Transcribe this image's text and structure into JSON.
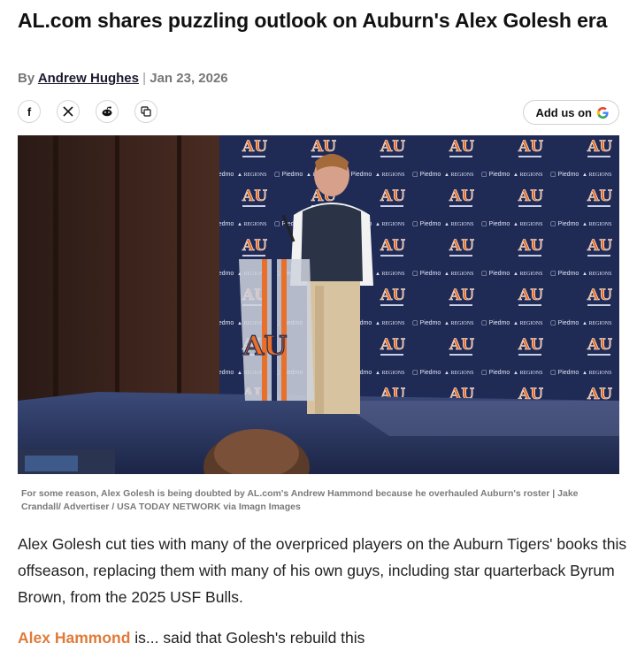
{
  "article": {
    "headline": "AL.com shares puzzling outlook on Auburn's Alex Golesh era",
    "byline": {
      "prefix": "By",
      "author": "Andrew Hughes",
      "separator": "|",
      "date": "Jan 23, 2026"
    },
    "share": {
      "facebook_label": "f",
      "add_us_label": "Add us on"
    },
    "image": {
      "backdrop_labels": [
        "Piedmont",
        "REGIONS"
      ],
      "podium_logo_letters": "AU"
    },
    "caption": "For some reason, Alex Golesh is being doubted by AL.com's Andrew Hammond because he overhauled Auburn's roster | Jake Crandall/ Advertiser / USA TODAY NETWORK via Imagn Images",
    "body_paragraph": "Alex Golesh cut ties with many of the overpriced players on the Auburn Tigers' books this offseason, replacing them with many of his own guys, including star quarterback Byrum Brown, from the 2025 USF Bulls.",
    "next_paragraph": {
      "lead": "Alex Hammond",
      "rest": "is... said that Golesh's rebuild this"
    }
  },
  "colors": {
    "brand_orange": "#e07b39",
    "backdrop_navy": "#1f2a55",
    "auburn_orange": "#e8702a",
    "stage_blue": "#2b3a6e"
  },
  "icons": {
    "facebook": "facebook-icon",
    "x": "x-twitter-icon",
    "reddit": "reddit-icon",
    "copy": "copy-link-icon",
    "google": "google-g-icon"
  }
}
